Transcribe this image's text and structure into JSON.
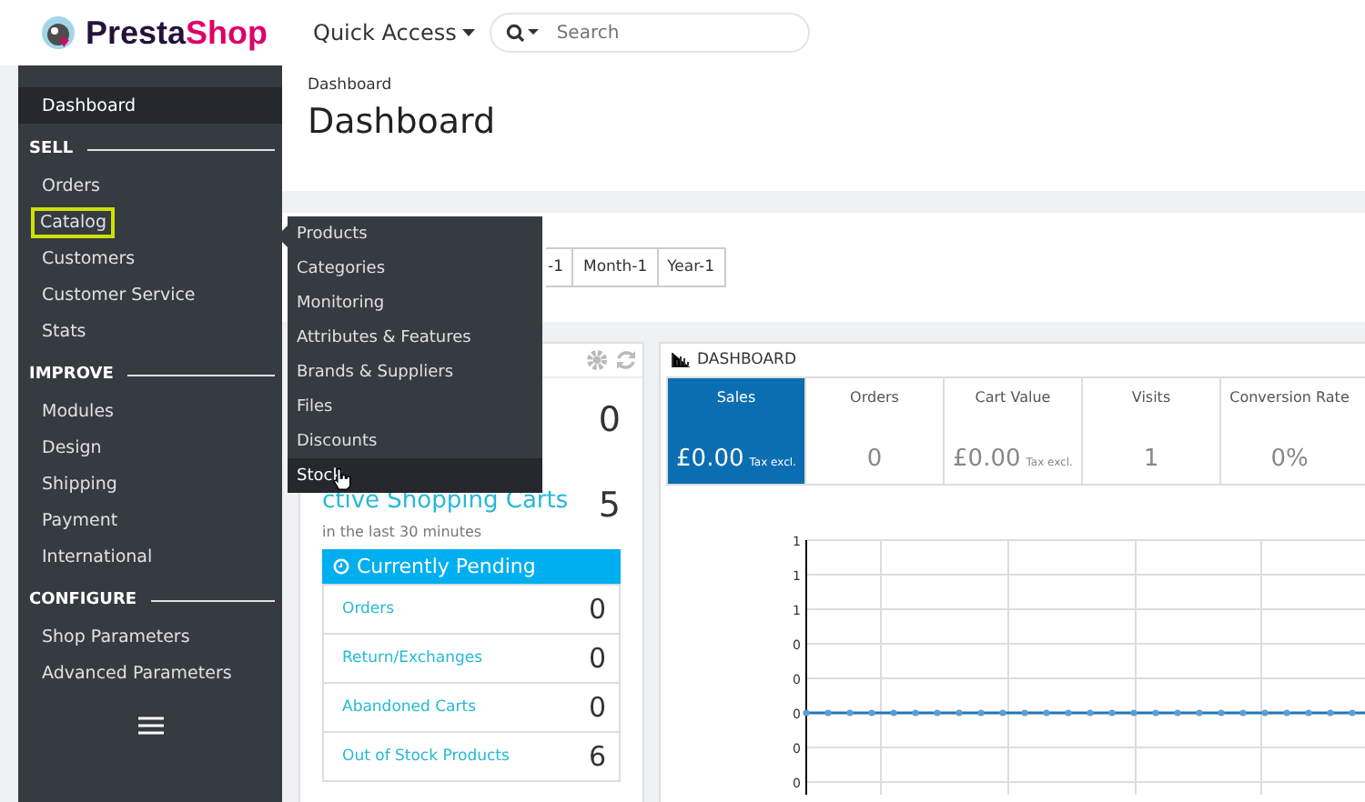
{
  "header": {
    "logo": "PrestaShop",
    "quick_access": "Quick Access",
    "search": {
      "placeholder": "Search"
    }
  },
  "sidebar": {
    "items": [
      {
        "kind": "item",
        "label": "Dashboard",
        "selected": true
      },
      {
        "kind": "section",
        "label": "SELL"
      },
      {
        "kind": "item",
        "label": "Orders",
        "selected": false
      },
      {
        "kind": "item",
        "label": "Catalog",
        "selected": false,
        "outlined": true
      },
      {
        "kind": "item",
        "label": "Customers",
        "selected": false
      },
      {
        "kind": "item",
        "label": "Customer Service",
        "selected": false
      },
      {
        "kind": "item",
        "label": "Stats",
        "selected": false
      },
      {
        "kind": "section",
        "label": "IMPROVE"
      },
      {
        "kind": "item",
        "label": "Modules",
        "selected": false
      },
      {
        "kind": "item",
        "label": "Design",
        "selected": false
      },
      {
        "kind": "item",
        "label": "Shipping",
        "selected": false
      },
      {
        "kind": "item",
        "label": "Payment",
        "selected": false
      },
      {
        "kind": "item",
        "label": "International",
        "selected": false
      },
      {
        "kind": "section",
        "label": "CONFIGURE"
      },
      {
        "kind": "item",
        "label": "Shop Parameters",
        "selected": false
      },
      {
        "kind": "item",
        "label": "Advanced Parameters",
        "selected": false
      }
    ]
  },
  "flyout": {
    "items": [
      {
        "label": "Products",
        "selected": false
      },
      {
        "label": "Categories",
        "selected": false
      },
      {
        "label": "Monitoring",
        "selected": false
      },
      {
        "label": "Attributes & Features",
        "selected": false
      },
      {
        "label": "Brands & Suppliers",
        "selected": false
      },
      {
        "label": "Files",
        "selected": false
      },
      {
        "label": "Discounts",
        "selected": false
      },
      {
        "label": "Stock",
        "selected": true
      }
    ]
  },
  "page": {
    "breadcrumb": "Dashboard",
    "title": "Dashboard"
  },
  "date_buttons": [
    "-1",
    "Month-1",
    "Year-1"
  ],
  "activity": {
    "top_value": "0",
    "carts_label": "ctive Shopping Carts",
    "carts_value": "5",
    "carts_note": "in the last 30 minutes",
    "pending_title": "Currently Pending",
    "rows": [
      {
        "label": "Orders",
        "value": "0"
      },
      {
        "label": "Return/Exchanges",
        "value": "0"
      },
      {
        "label": "Abandoned Carts",
        "value": "0"
      },
      {
        "label": "Out of Stock Products",
        "value": "6"
      }
    ]
  },
  "dashboard": {
    "title": "DASHBOARD",
    "kpis": [
      {
        "label": "Sales",
        "value": "£0.00",
        "note": "Tax excl.",
        "selected": true
      },
      {
        "label": "Orders",
        "value": "0",
        "selected": false
      },
      {
        "label": "Cart Value",
        "value": "£0.00",
        "note": "Tax excl.",
        "selected": false
      },
      {
        "label": "Visits",
        "value": "1",
        "selected": false
      },
      {
        "label": "Conversion Rate",
        "value": "0%",
        "selected": false
      }
    ],
    "chart": {
      "y_axis_labels": [
        "1",
        "1",
        "1",
        "0",
        "0",
        "0",
        "0",
        "0"
      ]
    }
  }
}
